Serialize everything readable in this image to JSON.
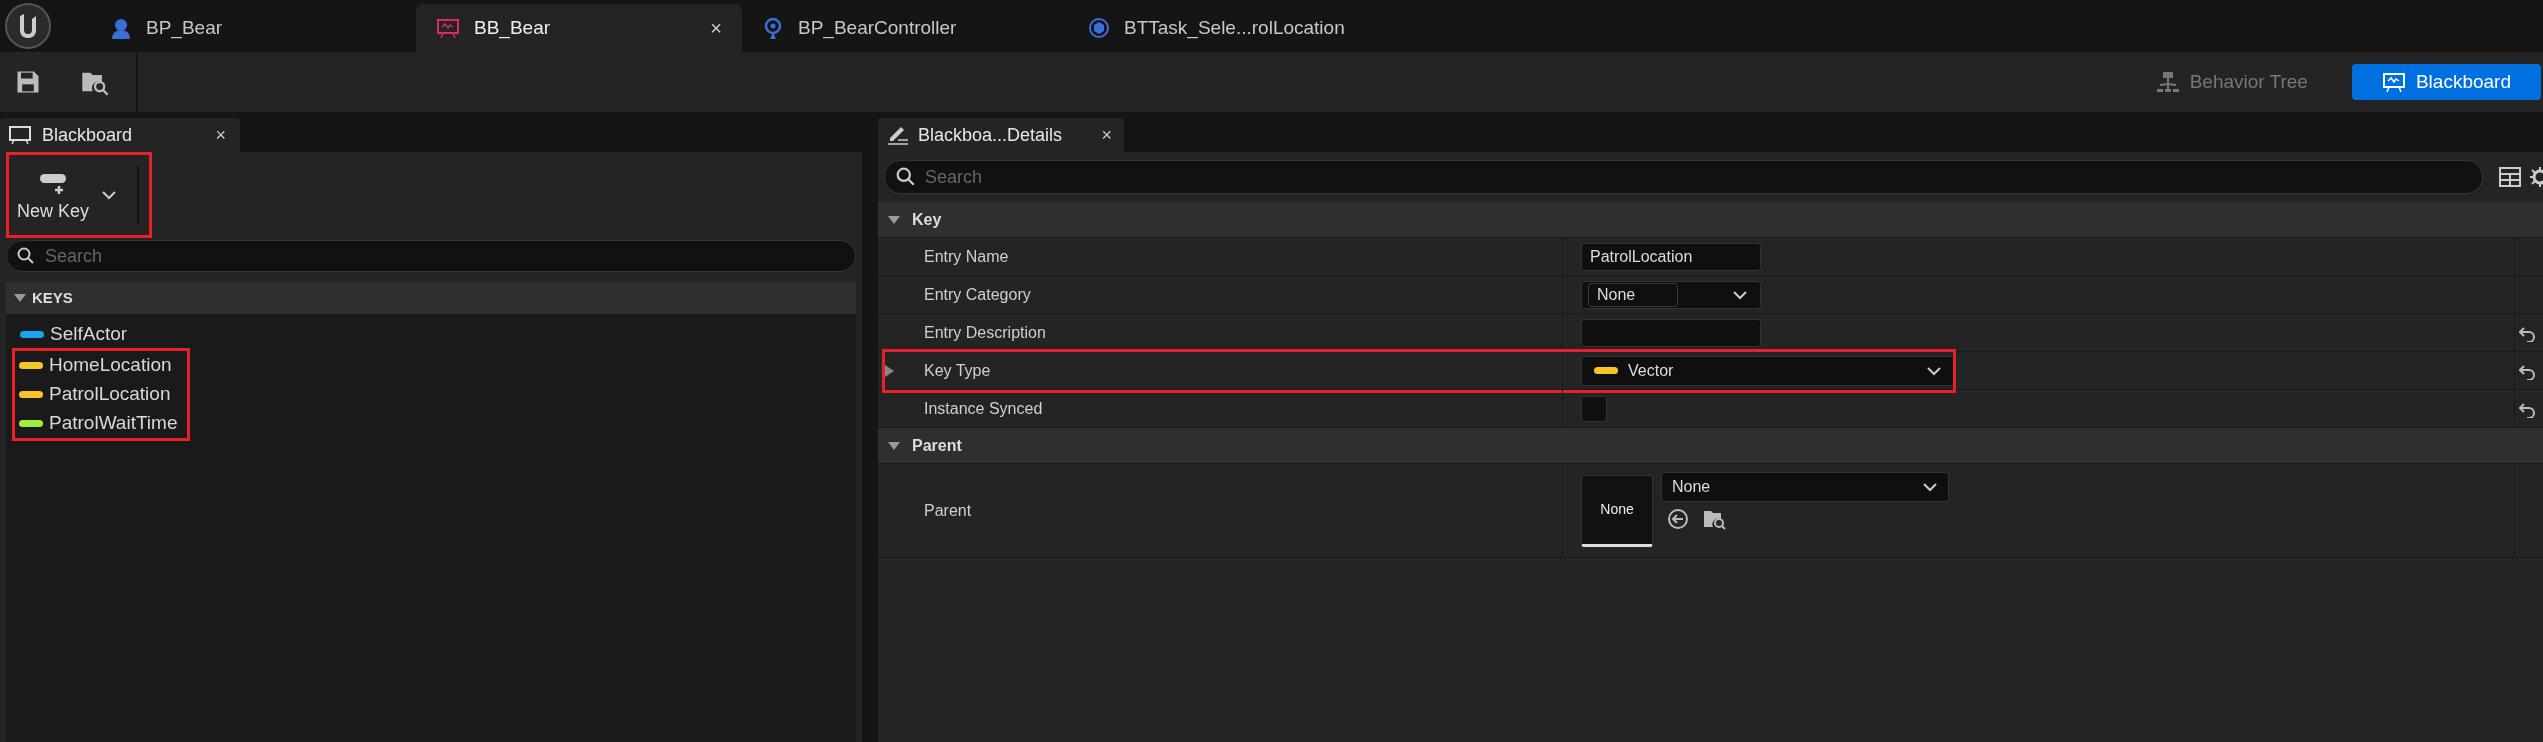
{
  "document_tabs": [
    {
      "label": "BP_Bear",
      "selected": false
    },
    {
      "label": "BB_Bear",
      "selected": true,
      "close": "×"
    },
    {
      "label": "BP_BearController",
      "selected": false
    },
    {
      "label": "BTTask_Sele...rolLocation",
      "selected": false
    }
  ],
  "mode_buttons": [
    {
      "label": "Behavior Tree",
      "selected": false
    },
    {
      "label": "Blackboard",
      "selected": true
    }
  ],
  "blackboard_panel": {
    "tab": "Blackboard",
    "tab_close": "×",
    "new_key": {
      "label": "New Key",
      "highlighted": true
    },
    "search": {
      "placeholder": "Search"
    },
    "section": {
      "title": "KEYS",
      "expanded": true
    },
    "keys": [
      {
        "name": "SelfActor",
        "color": "#1aa3f0",
        "highlighted": false
      },
      {
        "name": "HomeLocation",
        "color": "#f7c52a",
        "highlighted": true
      },
      {
        "name": "PatrolLocation",
        "color": "#f7c52a",
        "highlighted": true
      },
      {
        "name": "PatrolWaitTime",
        "color": "#9ef03c",
        "highlighted": true
      }
    ]
  },
  "details_panel": {
    "tab": "Blackboa...Details",
    "tab_close": "×",
    "search": {
      "placeholder": "Search"
    },
    "sections": [
      {
        "title": "Key",
        "expanded": true,
        "rows": [
          {
            "kind": "text",
            "label": "Entry Name",
            "value": "PatrolLocation",
            "highlighted": false,
            "reset": false
          },
          {
            "kind": "combo",
            "label": "Entry Category",
            "value": "None",
            "highlighted": false,
            "reset": false
          },
          {
            "kind": "text",
            "label": "Entry Description",
            "highlighted": false,
            "reset": true
          },
          {
            "kind": "type",
            "label": "Key Type",
            "value": "Vector",
            "color": "#f7c52a",
            "highlighted": true,
            "reset": true,
            "expandable": true
          },
          {
            "kind": "checkbox",
            "label": "Instance Synced",
            "checked": false,
            "highlighted": false,
            "reset": true
          }
        ]
      },
      {
        "title": "Parent",
        "expanded": true,
        "rows": [
          {
            "kind": "asset",
            "label": "Parent",
            "thumbnail": "None",
            "value": "None",
            "highlighted": false,
            "reset": false
          }
        ]
      }
    ]
  }
}
